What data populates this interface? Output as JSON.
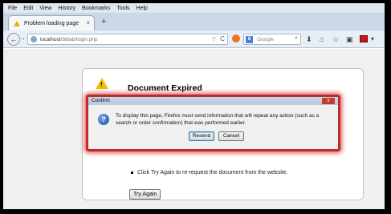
{
  "menubar": {
    "items": [
      "File",
      "Edit",
      "View",
      "History",
      "Bookmarks",
      "Tools",
      "Help"
    ]
  },
  "tab": {
    "title": "Problem loading page",
    "close_glyph": "×"
  },
  "newtab_glyph": "+",
  "nav": {
    "back_glyph": "←",
    "forward_glyph": "→",
    "url_host": "localhost",
    "url_path": "/bttlab/login.php",
    "star_glyph": "▽",
    "reload_glyph": "C",
    "search_engine_letter": "8",
    "search_placeholder": "Google",
    "search_glyph": "⌕",
    "toolbar_glyphs": [
      "⬇",
      "⌂",
      "☆",
      "▣"
    ],
    "menu_glyph": "▾"
  },
  "page": {
    "warning_mark": "!",
    "title": "Document Expired",
    "bullet": "Click Try Again to re-request the document from the website.",
    "try_again": "Try Again"
  },
  "dialog": {
    "title": "Confirm",
    "close_glyph": "x",
    "question_glyph": "?",
    "message": "To display this page, Firefox must send information that will repeat any action (such as a search or order confirmation) that was performed earlier.",
    "resend": "Resend",
    "cancel": "Cancel"
  },
  "colors": {
    "dialog_highlight": "#c12a2a",
    "warning_yellow": "#f0c000"
  }
}
